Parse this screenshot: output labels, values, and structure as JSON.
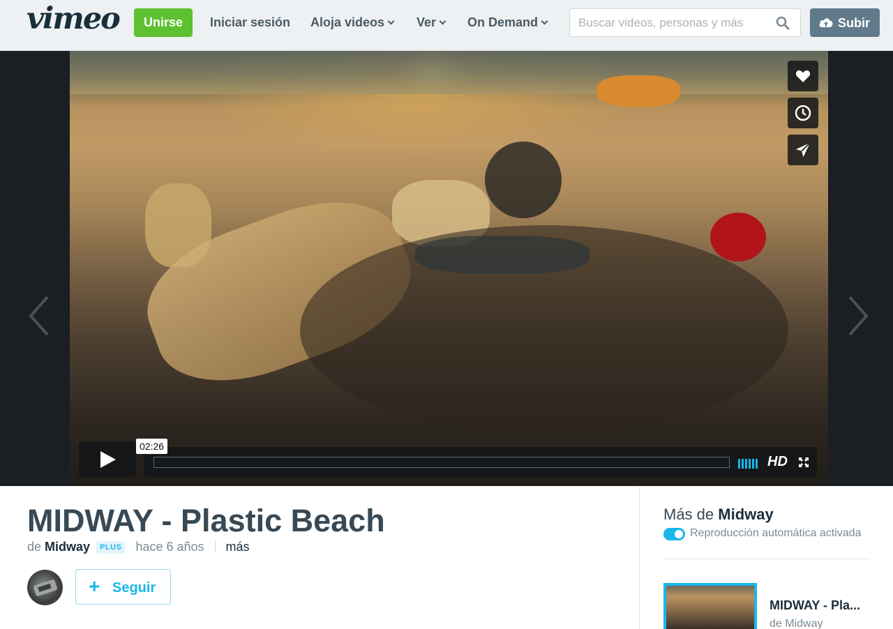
{
  "header": {
    "logo": "vimeo",
    "join_label": "Unirse",
    "nav": [
      {
        "label": "Iniciar sesión"
      },
      {
        "label": "Aloja videos"
      },
      {
        "label": "Ver"
      },
      {
        "label": "On Demand"
      }
    ],
    "search_placeholder": "Buscar videos, personas y más",
    "upload_label": "Subir"
  },
  "player": {
    "time_tooltip": "02:26",
    "hd_label": "HD",
    "side_icons": [
      "heart-icon",
      "clock-icon",
      "send-icon"
    ]
  },
  "video": {
    "title": "MIDWAY - Plastic Beach",
    "by_prefix": "de",
    "owner": "Midway",
    "badge": "PLUS",
    "age": "hace 6 años",
    "more_label": "más",
    "follow_label": "Seguir"
  },
  "sidebar": {
    "more_prefix": "Más de",
    "more_owner": "Midway",
    "autoplay_label": "Reproducción automática activada",
    "related": [
      {
        "title": "MIDWAY - Pla...",
        "by": "de Midway"
      }
    ]
  },
  "colors": {
    "brand_green": "#5ec130",
    "accent_blue": "#1ab7ea",
    "upload_gray": "#607a8b"
  }
}
